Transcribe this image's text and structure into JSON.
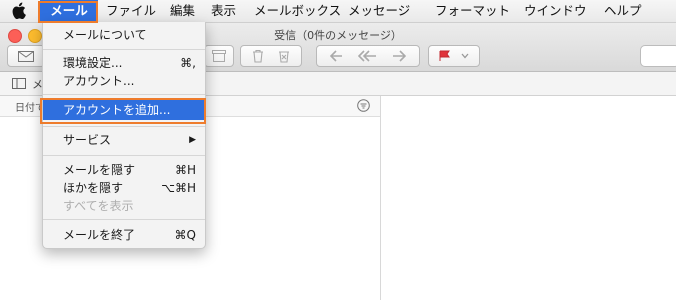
{
  "menubar": {
    "items": [
      "メール",
      "ファイル",
      "編集",
      "表示",
      "メールボックス",
      "メッセージ",
      "フォーマット",
      "ウインドウ",
      "ヘルプ"
    ]
  },
  "window": {
    "title": "受信（0件のメッセージ）",
    "sort_label": "日付で",
    "mailbar_label": "メ"
  },
  "mail_menu": {
    "about": "メールについて",
    "preferences": {
      "label": "環境設定...",
      "shortcut": "⌘,"
    },
    "accounts": "アカウント...",
    "add_account": "アカウントを追加...",
    "services": {
      "label": "サービス",
      "arrow": "▶"
    },
    "hide_mail": {
      "label": "メールを隠す",
      "shortcut": "⌘H"
    },
    "hide_others": {
      "label": "ほかを隠す",
      "shortcut": "⌥⌘H"
    },
    "show_all": "すべてを表示",
    "quit": {
      "label": "メールを終了",
      "shortcut": "⌘Q"
    }
  },
  "colors": {
    "accent": "#2f6fde",
    "callout": "#ee7c2c",
    "flag": "#e0333a"
  }
}
